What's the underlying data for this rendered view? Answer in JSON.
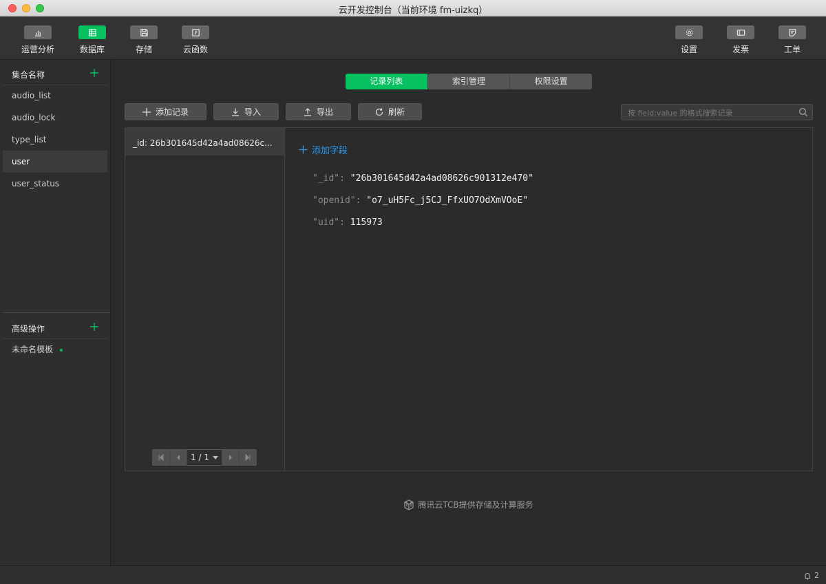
{
  "window": {
    "title": "云开发控制台（当前环境 fm-uizkq）"
  },
  "toolbar": {
    "left": [
      {
        "label": "运营分析",
        "icon": "bar-chart-icon"
      },
      {
        "label": "数据库",
        "icon": "database-icon"
      },
      {
        "label": "存储",
        "icon": "storage-icon"
      },
      {
        "label": "云函数",
        "icon": "function-icon"
      }
    ],
    "right": [
      {
        "label": "设置",
        "icon": "gear-icon"
      },
      {
        "label": "发票",
        "icon": "invoice-icon"
      },
      {
        "label": "工单",
        "icon": "ticket-icon"
      }
    ]
  },
  "sidebar": {
    "collections_title": "集合名称",
    "collections": [
      {
        "name": "audio_list"
      },
      {
        "name": "audio_lock"
      },
      {
        "name": "type_list"
      },
      {
        "name": "user"
      },
      {
        "name": "user_status"
      }
    ],
    "selected_collection": "user",
    "advanced_title": "高级操作",
    "templates": [
      {
        "name": "未命名模板"
      }
    ]
  },
  "main": {
    "tabs": [
      {
        "label": "记录列表"
      },
      {
        "label": "索引管理"
      },
      {
        "label": "权限设置"
      }
    ],
    "active_tab": "记录列表",
    "actions": {
      "add_record": "添加记录",
      "import": "导入",
      "export": "导出",
      "refresh": "刷新"
    },
    "search": {
      "placeholder": "按 field:value 的格式搜索记录",
      "value": ""
    },
    "records": [
      {
        "label": "_id: 26b301645d42a4ad08626c..."
      }
    ],
    "pager": {
      "text": "1 / 1"
    },
    "add_field_label": "添加字段",
    "fields": [
      {
        "key": "\"_id\":",
        "value": "\"26b301645d42a4ad08626c901312e470\""
      },
      {
        "key": "\"openid\":",
        "value": "\"o7_uH5Fc_j5CJ_FfxUO7OdXmVOoE\""
      },
      {
        "key": "\"uid\":",
        "value": "115973"
      }
    ],
    "footer": "腾讯云TCB提供存储及计算服务"
  },
  "statusbar": {
    "notifications": "2"
  },
  "colors": {
    "accent": "#07c160",
    "link": "#2e9bf0"
  }
}
